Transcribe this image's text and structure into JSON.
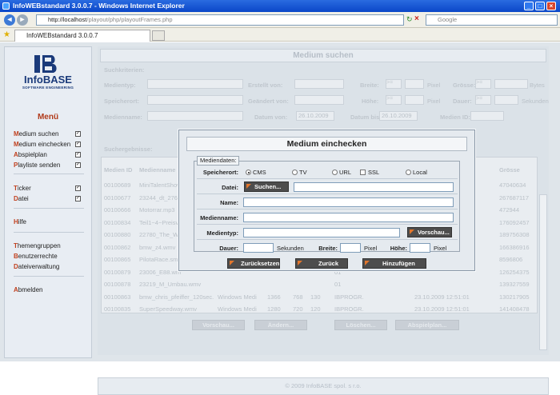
{
  "window": {
    "title": "InfoWEBstandard 3.0.0.7 - Windows Internet Explorer"
  },
  "browser": {
    "address_prefix": "http://localhost",
    "address_rest": "/playout/php/playoutFrames.php",
    "search_placeholder": "Google",
    "tab_title": "InfoWEBstandard 3.0.0.7"
  },
  "logo": {
    "name": "InfoBASE",
    "tagline": "SOFTWARE ENGINEERING"
  },
  "sidebar": {
    "heading": "Menü",
    "items": [
      {
        "hotkey": "M",
        "rest": "edium suchen"
      },
      {
        "hotkey": "M",
        "rest": "edium einchecken"
      },
      {
        "hotkey": "A",
        "rest": "bspielplan"
      },
      {
        "hotkey": "P",
        "rest": "layliste senden"
      },
      {
        "hotkey": "T",
        "rest": "icker"
      },
      {
        "hotkey": "D",
        "rest": "atei"
      },
      {
        "hotkey": "H",
        "rest": "ilfe"
      },
      {
        "hotkey": "T",
        "rest": "hemengruppen"
      },
      {
        "hotkey": "B",
        "rest": "enutzerrechte"
      },
      {
        "hotkey": "D",
        "rest": "ateiverwaltung"
      },
      {
        "hotkey": "A",
        "rest": "bmelden"
      }
    ]
  },
  "background": {
    "title": "Medium suchen",
    "criteria_legend": "Suchkriterien:",
    "labels": {
      "medientyp": "Medientyp:",
      "speicherort": "Speicherort:",
      "medienname": "Medienname:",
      "erstellt": "Erstellt von:",
      "geaendert": "Geändert von:",
      "datum_von": "Datum von:",
      "datum_bis": "Datum bis:",
      "breite": "Breite:",
      "hoehe": "Höhe:",
      "groesse": "Grösse:",
      "dauer": "Dauer:",
      "medien_id": "Medien ID:",
      "pixel": "Pixel",
      "bytes": "Bytes",
      "sekunden": "Sekunden",
      "op": ">="
    },
    "date_from": "26.10.2009",
    "date_to": "26.10.2009",
    "results_legend": "Suchergebnisse:",
    "columns": [
      "Medien ID",
      "Medienname",
      "Grösse"
    ],
    "rows": [
      {
        "id": "00100689",
        "name": "MiniTalentShow",
        "c": "",
        "d": "",
        "e": "",
        "f": "",
        "g": "",
        "size": "47040634"
      },
      {
        "id": "00100677",
        "name": "23244_dt_276x",
        "c": "",
        "d": "",
        "e": "",
        "f": "",
        "g": "01",
        "size": "267687117"
      },
      {
        "id": "00100666",
        "name": "Motorrar.mp3",
        "c": "",
        "d": "",
        "e": "",
        "f": "",
        "g": "01",
        "size": "472944"
      },
      {
        "id": "00100834",
        "name": "Teil1~4~Preisv",
        "c": "",
        "d": "",
        "e": "",
        "f": "",
        "g": "01",
        "size": "176092457"
      },
      {
        "id": "00100880",
        "name": "22780_The_Wa",
        "c": "",
        "d": "",
        "e": "",
        "f": "",
        "g": "01",
        "size": "189756308"
      },
      {
        "id": "00100862",
        "name": "bmw_z4.wmv",
        "c": "",
        "d": "",
        "e": "",
        "f": "",
        "g": "01",
        "size": "166386916"
      },
      {
        "id": "00100865",
        "name": "PilotaRace.sm",
        "c": "",
        "d": "",
        "e": "",
        "f": "",
        "g": "01",
        "size": "8596806"
      },
      {
        "id": "00100879",
        "name": "23006_E88.wm",
        "c": "",
        "d": "",
        "e": "",
        "f": "",
        "g": "01",
        "size": "126254375"
      },
      {
        "id": "00100878",
        "name": "23219_M_Umbau.wmv",
        "c": "",
        "d": "",
        "e": "",
        "f": "",
        "g": "01",
        "size": "139327559"
      },
      {
        "id": "00100863",
        "name": "bmw_chris_pfeiffer_120sec.",
        "c": "Windows Medi",
        "d": "1366",
        "e": "768",
        "f": "130",
        "g": "IBPROGR.",
        "date": "23.10.2009 12:51:01",
        "size": "130217905"
      },
      {
        "id": "00100835",
        "name": "SuperSpeedway.wmv",
        "c": "Windows Medi",
        "d": "1280",
        "e": "720",
        "f": "120",
        "g": "IBPROGR.",
        "date": "23.10.2009 12:51:01",
        "size": "141408478"
      }
    ],
    "buttons": [
      "Vorschau...",
      "Ändern...",
      "Löschen...",
      "Abspielplan..."
    ],
    "footer": "© 2009 InfoBASE spol. s r.o."
  },
  "dialog": {
    "title": "Medium einchecken",
    "legend": "Mediendaten:",
    "labels": {
      "speicherort": "Speicherort:",
      "datei": "Datei:",
      "name": "Name:",
      "medienname": "Medienname:",
      "medientyp": "Medientyp:",
      "dauer": "Dauer:",
      "sekunden": "Sekunden",
      "breite": "Breite:",
      "pixel1": "Pixel",
      "hoehe": "Höhe:",
      "pixel2": "Pixel"
    },
    "options": {
      "cms": "CMS",
      "tv": "TV",
      "url": "URL",
      "ssl": "SSL",
      "local": "Local"
    },
    "buttons": {
      "suchen": "Suchen...",
      "vorschau": "Vorschau...",
      "reset": "Zurücksetzen",
      "zurueck": "Zurück",
      "hinzufuegen": "Hinzufügen"
    }
  }
}
